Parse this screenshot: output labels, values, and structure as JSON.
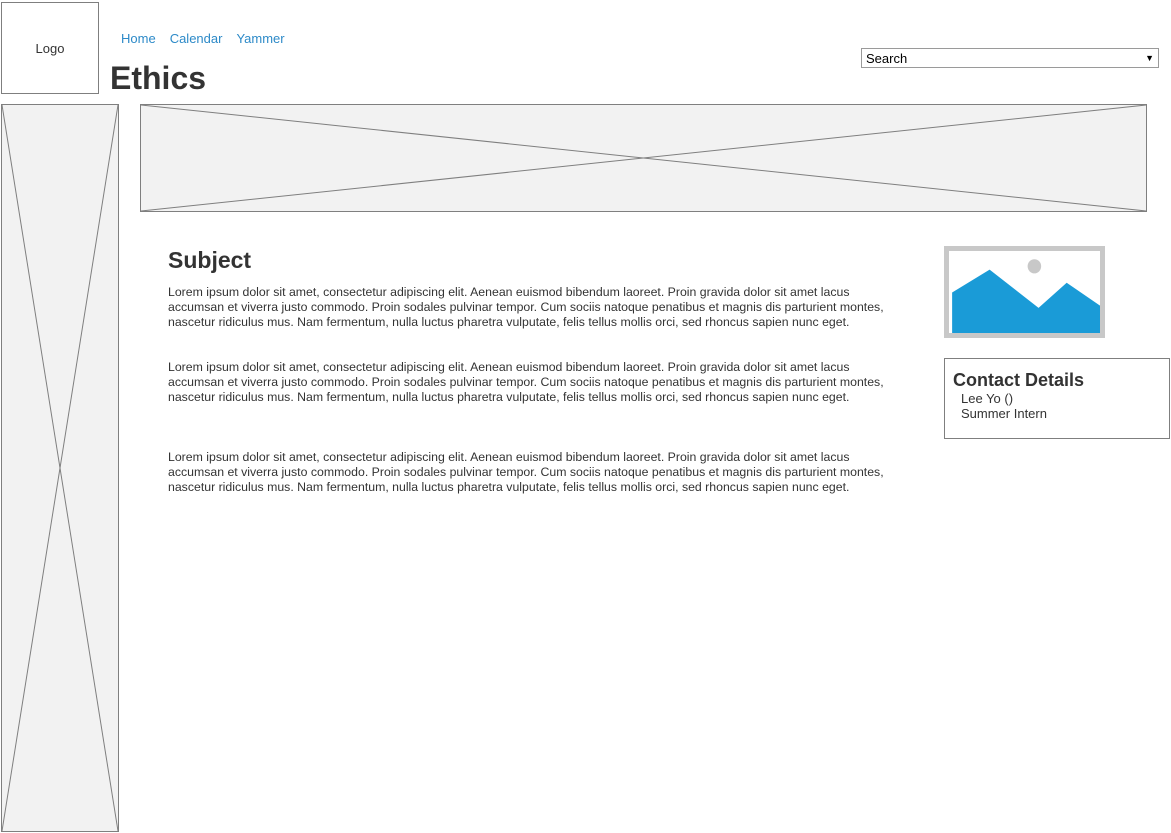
{
  "logo": {
    "label": "Logo"
  },
  "nav": {
    "items": [
      {
        "label": "Home"
      },
      {
        "label": "Calendar"
      },
      {
        "label": "Yammer"
      }
    ]
  },
  "page": {
    "title": "Ethics"
  },
  "search": {
    "value": "Search",
    "caret": "▼"
  },
  "article": {
    "subject": "Subject",
    "paragraphs": [
      "Lorem ipsum dolor sit amet, consectetur adipiscing elit. Aenean euismod bibendum laoreet. Proin gravida dolor sit amet lacus accumsan et viverra justo commodo. Proin sodales pulvinar tempor. Cum sociis natoque penatibus et magnis dis parturient montes, nascetur ridiculus mus. Nam fermentum, nulla luctus pharetra vulputate, felis tellus mollis orci, sed rhoncus sapien nunc eget.",
      "Lorem ipsum dolor sit amet, consectetur adipiscing elit. Aenean euismod bibendum laoreet. Proin gravida dolor sit amet lacus accumsan et viverra justo commodo. Proin sodales pulvinar tempor. Cum sociis natoque penatibus et magnis dis parturient montes, nascetur ridiculus mus. Nam fermentum, nulla luctus pharetra vulputate, felis tellus mollis orci, sed rhoncus sapien nunc eget.",
      "Lorem ipsum dolor sit amet, consectetur adipiscing elit. Aenean euismod bibendum laoreet. Proin gravida dolor sit amet lacus accumsan et viverra justo commodo. Proin sodales pulvinar tempor. Cum sociis natoque penatibus et magnis dis parturient montes, nascetur ridiculus mus. Nam fermentum, nulla luctus pharetra vulputate, felis tellus mollis orci, sed rhoncus sapien nunc eget."
    ]
  },
  "contact": {
    "heading": "Contact Details",
    "name": "Lee Yo ()",
    "role": "Summer Intern"
  },
  "colors": {
    "link": "#2d8ac8",
    "image_fill": "#1a9bd7",
    "placeholder_bg": "#f2f2f2",
    "border": "#7f7f7f"
  }
}
